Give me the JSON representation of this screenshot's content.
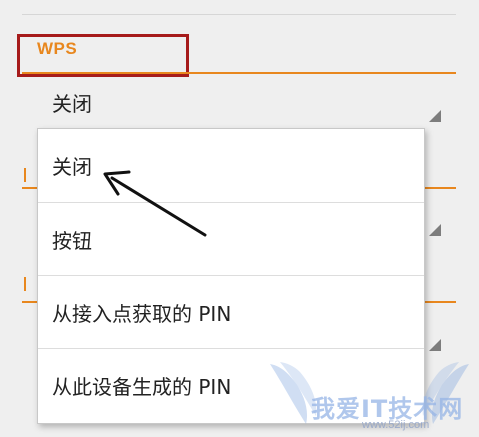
{
  "section": {
    "title": "WPS",
    "current_value": "关闭"
  },
  "dropdown": {
    "options": [
      {
        "label": "关闭"
      },
      {
        "label": "按钮"
      },
      {
        "label": "从接入点获取的 PIN"
      },
      {
        "label": "从此设备生成的 PIN"
      }
    ]
  },
  "watermark": {
    "text": "我爱IT技术网",
    "url": "www.52ij.com"
  },
  "colors": {
    "accent": "#e8871e",
    "highlight_box": "#a61b1b",
    "arrow": "#111111"
  }
}
